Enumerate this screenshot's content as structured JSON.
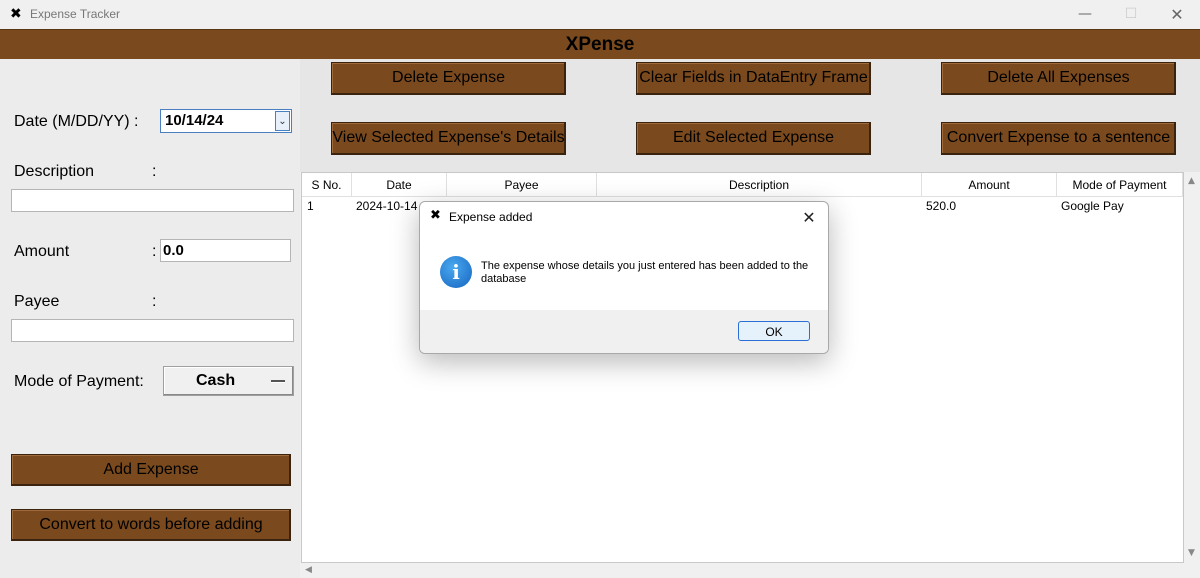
{
  "window": {
    "app_icon": "✖",
    "title": "Expense Tracker",
    "minimize": "—",
    "maximize": "☐",
    "close": "✕"
  },
  "banner": {
    "title": "XPense"
  },
  "form": {
    "date_label": "Date (M/DD/YY) :",
    "date_value": "10/14/24",
    "dropdown_glyph": "⌄",
    "description_label": "Description",
    "description_value": "",
    "amount_label": "Amount",
    "amount_value": "0.0",
    "payee_label": "Payee",
    "payee_value": "",
    "mop_label": "Mode of Payment:",
    "mop_value": "Cash",
    "colon": ":",
    "add_button": "Add Expense",
    "convert_button": "Convert to words before adding"
  },
  "actions": {
    "delete": "Delete Expense",
    "clear": "Clear Fields in DataEntry Frame",
    "delete_all": "Delete All Expenses",
    "view": "View Selected Expense's Details",
    "edit": "Edit Selected Expense",
    "to_sentence": "Convert Expense to a sentence"
  },
  "table": {
    "columns": [
      "S No.",
      "Date",
      "Payee",
      "Description",
      "Amount",
      "Mode of Payment"
    ],
    "rows": [
      {
        "sno": "1",
        "date": "2024-10-14",
        "payee": "",
        "description": "",
        "amount": "520.0",
        "mode": "Google Pay"
      }
    ]
  },
  "dialog": {
    "icon": "✖",
    "title": "Expense added",
    "close": "✕",
    "info_glyph": "i",
    "message": "The expense whose details you just entered has been added to the database",
    "ok": "OK"
  },
  "colors": {
    "brown": "#7a4a1e",
    "info_blue": "#1565c0"
  }
}
